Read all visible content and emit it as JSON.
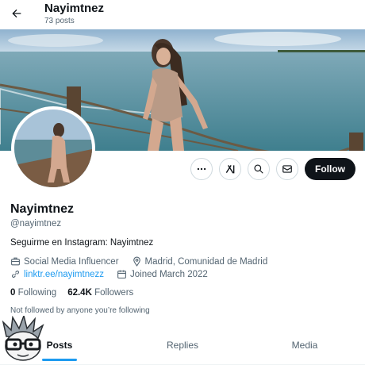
{
  "header": {
    "name": "Nayimtnez",
    "posts_count": "73 posts"
  },
  "profile": {
    "display_name": "Nayimtnez",
    "handle": "@nayimtnez",
    "bio": "Seguirme en Instagram: Nayimtnez",
    "category": "Social Media Influencer",
    "location": "Madrid, Comunidad de Madrid",
    "link": "linktr.ee/nayimtnezz",
    "joined": "Joined March 2022",
    "following_count": "0",
    "following_label": "Following",
    "followers_count": "62.4K",
    "followers_label": "Followers",
    "followed_note": "Not followed by anyone you’re following"
  },
  "actions": {
    "follow_label": "Follow"
  },
  "tabs": [
    {
      "label": "Posts",
      "active": true
    },
    {
      "label": "Replies",
      "active": false
    },
    {
      "label": "Media",
      "active": false
    }
  ],
  "colors": {
    "accent": "#1d9bf0",
    "primary_button": "#0f1419",
    "secondary_text": "#536471"
  },
  "icons": [
    "back-arrow-icon",
    "more-icon",
    "grok-icon",
    "search-icon",
    "message-icon",
    "briefcase-icon",
    "location-icon",
    "link-icon",
    "calendar-icon"
  ]
}
